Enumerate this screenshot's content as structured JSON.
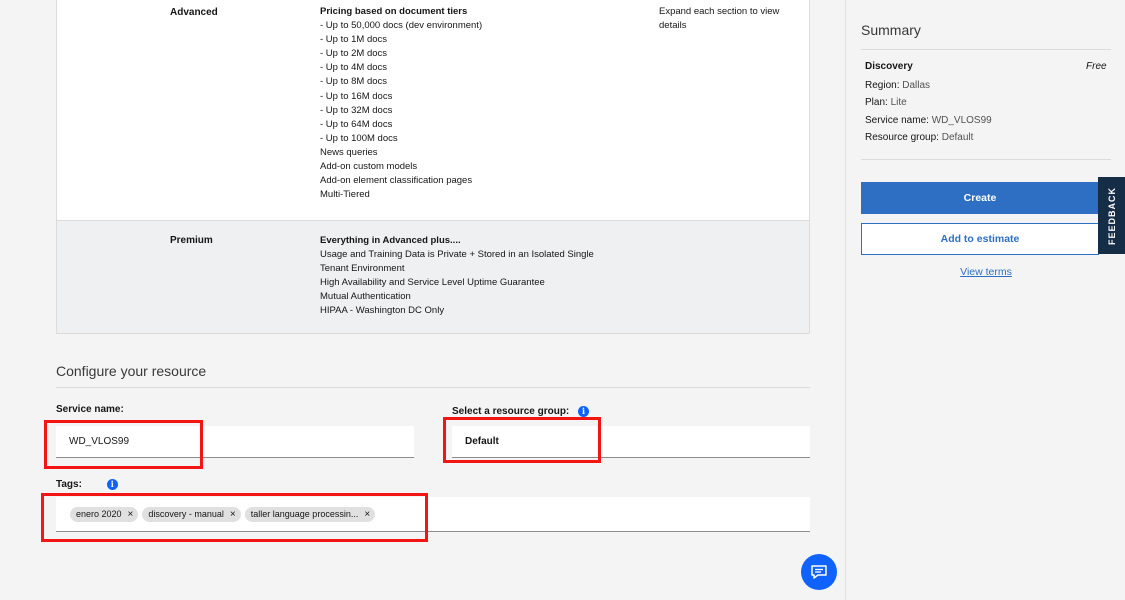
{
  "plans": {
    "advanced": {
      "name": "Advanced",
      "features_title": "Pricing based on document tiers",
      "features": [
        "- Up to 50,000 docs (dev environment)",
        "- Up to 1M docs",
        "- Up to 2M docs",
        "- Up to 4M docs",
        "- Up to 8M docs",
        "- Up to 16M docs",
        "- Up to 32M docs",
        "- Up to 64M docs",
        "- Up to 100M docs",
        "News queries",
        "Add-on custom models",
        "Add-on element classification pages",
        "Multi-Tiered"
      ],
      "note": "Expand each section to view details"
    },
    "premium": {
      "name": "Premium",
      "features_title": "Everything in Advanced plus....",
      "features": [
        "Usage and Training Data is Private + Stored in an Isolated Single",
        "Tenant Environment",
        "High Availability and Service Level Uptime Guarantee",
        "Mutual Authentication",
        "HIPAA - Washington DC Only"
      ]
    }
  },
  "configure": {
    "title": "Configure your resource",
    "service_name_label": "Service name:",
    "service_name_value": "WD_VLOS99",
    "resource_group_label": "Select a resource group:",
    "resource_group_value": "Default",
    "tags_label": "Tags:",
    "tags": [
      "enero 2020",
      "discovery - manual",
      "taller language processin..."
    ]
  },
  "summary": {
    "title": "Summary",
    "product": "Discovery",
    "price": "Free",
    "region_label": "Region:",
    "region_value": "Dallas",
    "plan_label": "Plan:",
    "plan_value": "Lite",
    "service_name_label": "Service name:",
    "service_name_value": "WD_VLOS99",
    "resource_group_label": "Resource group:",
    "resource_group_value": "Default",
    "create_label": "Create",
    "estimate_label": "Add to estimate",
    "terms_label": "View terms"
  },
  "feedback_label": "FEEDBACK",
  "colors": {
    "accent": "#2e6fc4",
    "highlight": "#f31414",
    "feedback_bg": "#152d47"
  },
  "icons": {
    "info": "info-icon",
    "tag_remove": "close-icon",
    "chat": "chat-icon"
  }
}
